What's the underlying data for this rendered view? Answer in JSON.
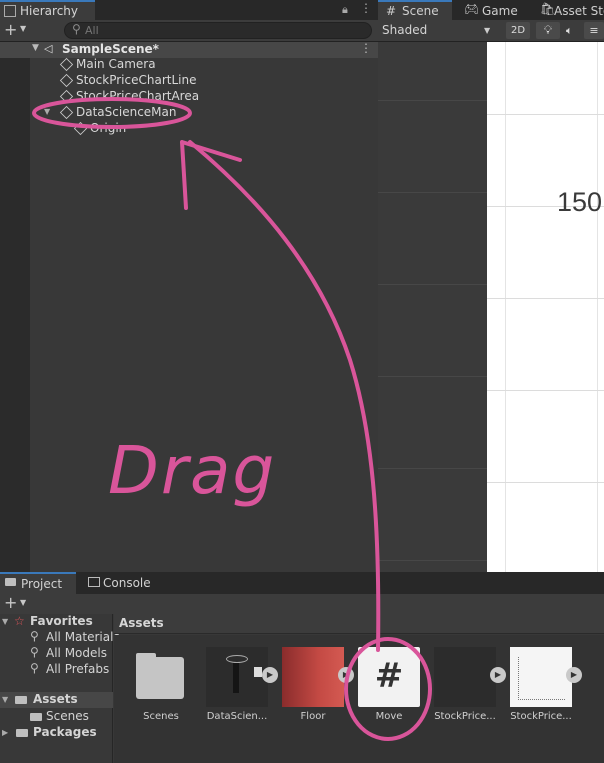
{
  "hierarchy": {
    "tab_label": "Hierarchy",
    "search_placeholder": "All",
    "scene_name": "SampleScene*",
    "items": [
      {
        "label": "Main Camera"
      },
      {
        "label": "StockPriceChartLine"
      },
      {
        "label": "StockPriceChartArea"
      },
      {
        "label": "DataScienceMan"
      },
      {
        "label": "Origin"
      }
    ]
  },
  "scene_view": {
    "tabs": [
      {
        "label": "Scene",
        "icon": "grid-icon"
      },
      {
        "label": "Game",
        "icon": "gamepad-icon"
      },
      {
        "label": "Asset Sto",
        "icon": "store-icon"
      }
    ],
    "shading_mode": "Shaded",
    "toggle_2d": "2D",
    "chart_label": "150"
  },
  "project": {
    "tabs": [
      {
        "label": "Project",
        "icon": "folder-icon"
      },
      {
        "label": "Console",
        "icon": "console-icon"
      }
    ],
    "tree": {
      "favorites": "Favorites",
      "favorite_items": [
        "All Materials",
        "All Models",
        "All Prefabs"
      ],
      "assets": "Assets",
      "asset_items": [
        "Scenes"
      ],
      "packages": "Packages"
    },
    "assets_header": "Assets",
    "assets": [
      {
        "name": "Scenes",
        "type": "folder"
      },
      {
        "name": "DataScien...",
        "type": "prefab"
      },
      {
        "name": "Floor",
        "type": "material"
      },
      {
        "name": "Move",
        "type": "script"
      },
      {
        "name": "StockPrice...",
        "type": "prefab"
      },
      {
        "name": "StockPrice...",
        "type": "prefab"
      }
    ]
  },
  "annotation": {
    "text": "Drag",
    "color": "#d9559a"
  },
  "colors": {
    "accent_tab": "#3a79bb",
    "annotation_pink": "#d9559a"
  }
}
